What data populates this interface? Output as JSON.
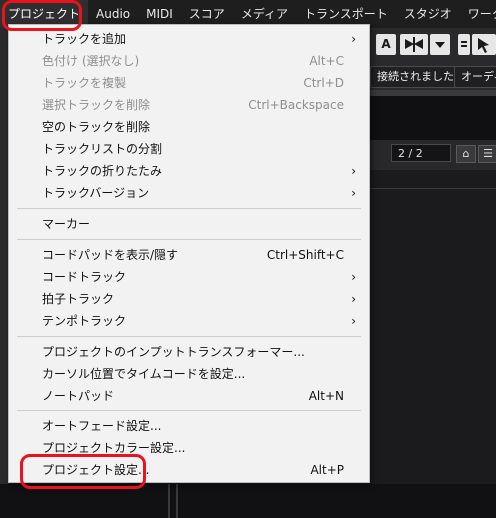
{
  "menubar": {
    "items": [
      {
        "label": "プロジェクト"
      },
      {
        "label": "Audio"
      },
      {
        "label": "MIDI"
      },
      {
        "label": "スコア"
      },
      {
        "label": "メディア"
      },
      {
        "label": "トランスポート"
      },
      {
        "label": "スタジオ"
      },
      {
        "label": "ワークスペース"
      }
    ]
  },
  "toolbar": {
    "text_tool": "A",
    "status_connected": "接続されました",
    "status_audio": "オーディオ"
  },
  "panel": {
    "page_counter": "2 / 2"
  },
  "menu": {
    "items": [
      {
        "label": "トラックを追加",
        "shortcut": "",
        "submenu": true,
        "disabled": false
      },
      {
        "label": "色付け (選択なし)",
        "shortcut": "Alt+C",
        "submenu": false,
        "disabled": true
      },
      {
        "label": "トラックを複製",
        "shortcut": "Ctrl+D",
        "submenu": false,
        "disabled": true
      },
      {
        "label": "選択トラックを削除",
        "shortcut": "Ctrl+Backspace",
        "submenu": false,
        "disabled": true
      },
      {
        "label": "空のトラックを削除",
        "shortcut": "",
        "submenu": false,
        "disabled": false
      },
      {
        "label": "トラックリストの分割",
        "shortcut": "",
        "submenu": false,
        "disabled": false
      },
      {
        "label": "トラックの折りたたみ",
        "shortcut": "",
        "submenu": true,
        "disabled": false
      },
      {
        "label": "トラックバージョン",
        "shortcut": "",
        "submenu": true,
        "disabled": false
      },
      {
        "label": "マーカー",
        "shortcut": "",
        "submenu": false,
        "disabled": false
      },
      {
        "label": "コードパッドを表示/隠す",
        "shortcut": "Ctrl+Shift+C",
        "submenu": false,
        "disabled": false
      },
      {
        "label": "コードトラック",
        "shortcut": "",
        "submenu": true,
        "disabled": false
      },
      {
        "label": "拍子トラック",
        "shortcut": "",
        "submenu": true,
        "disabled": false
      },
      {
        "label": "テンポトラック",
        "shortcut": "",
        "submenu": true,
        "disabled": false
      },
      {
        "label": "プロジェクトのインプットトランスフォーマー...",
        "shortcut": "",
        "submenu": false,
        "disabled": false
      },
      {
        "label": "カーソル位置でタイムコードを設定...",
        "shortcut": "",
        "submenu": false,
        "disabled": false
      },
      {
        "label": "ノートパッド",
        "shortcut": "Alt+N",
        "submenu": false,
        "disabled": false
      },
      {
        "label": "オートフェード設定...",
        "shortcut": "",
        "submenu": false,
        "disabled": false
      },
      {
        "label": "プロジェクトカラー設定...",
        "shortcut": "",
        "submenu": false,
        "disabled": false
      },
      {
        "label": "プロジェクト設定...",
        "shortcut": "Alt+P",
        "submenu": false,
        "disabled": false
      }
    ]
  },
  "colors": {
    "highlight": "#e8131b",
    "menu_bg": "#f2f2f2",
    "menubar_bg": "#1e1e1f"
  },
  "icons": {
    "submenu": "chevron-right-icon",
    "toolbar": [
      "text-tool-icon",
      "snap-icon",
      "dropdown-icon",
      "list-icon",
      "cursor-icon"
    ]
  }
}
